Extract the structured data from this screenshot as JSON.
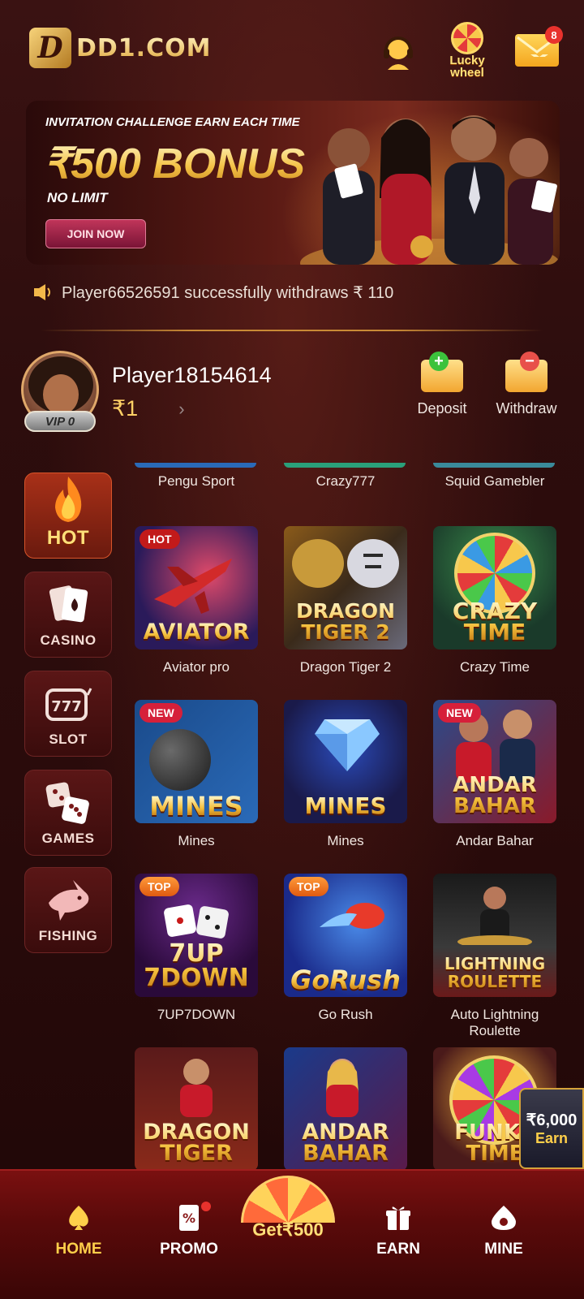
{
  "header": {
    "logo_text": "DD1.COM",
    "lucky_label": "Lucky wheel",
    "mail_count": "8"
  },
  "banner": {
    "subtitle": "INVITATION CHALLENGE EARN EACH TIME",
    "title": "₹500 BONUS",
    "no_limit": "NO LIMIT",
    "join": "JOIN NOW"
  },
  "marquee": {
    "text": "Player66526591 successfully withdraws ₹ 110"
  },
  "player": {
    "name": "Player18154614",
    "balance": "₹1",
    "vip": "VIP 0",
    "deposit": "Deposit",
    "withdraw": "Withdraw"
  },
  "sidebar": {
    "items": [
      {
        "label": "HOT"
      },
      {
        "label": "CASINO"
      },
      {
        "label": "SLOT"
      },
      {
        "label": "GAMES"
      },
      {
        "label": "FISHING"
      }
    ]
  },
  "games": {
    "top_row": [
      "Pengu Sport",
      "Crazy777",
      "Squid Gamebler"
    ],
    "tiles": [
      {
        "title": "AVIATOR",
        "name": "Aviator pro",
        "tag": "HOT"
      },
      {
        "title": "DRAGON TIGER 2",
        "name": "Dragon Tiger 2",
        "tag": ""
      },
      {
        "title": "CRAZY TIME",
        "name": "Crazy Time",
        "tag": ""
      },
      {
        "title": "MINES",
        "name": "Mines",
        "tag": "NEW"
      },
      {
        "title": "MINES",
        "name": "Mines",
        "tag": ""
      },
      {
        "title": "ANDAR BAHAR",
        "name": "Andar Bahar",
        "tag": "NEW"
      },
      {
        "title": "7UP 7DOWN",
        "name": "7UP7DOWN",
        "tag": "TOP"
      },
      {
        "title": "GoRush",
        "name": "Go Rush",
        "tag": "TOP"
      },
      {
        "title": "LIGHTNING ROULETTE",
        "name": "Auto Lightning Roulette",
        "tag": ""
      },
      {
        "title": "DRAGON TIGER",
        "name": "",
        "tag": ""
      },
      {
        "title": "ANDAR BAHAR",
        "name": "",
        "tag": ""
      },
      {
        "title": "FUNKY TIME",
        "name": "",
        "tag": ""
      }
    ]
  },
  "float_earn": {
    "amount": "₹6,000",
    "label": "Earn"
  },
  "bottom_nav": {
    "home": "HOME",
    "promo": "PROMO",
    "get": "Get₹500",
    "earn": "EARN",
    "mine": "MINE"
  },
  "colors": {
    "accent_gold": "#ffcf4a",
    "background": "#2a0c0c",
    "nav_red": "#7a1010"
  }
}
